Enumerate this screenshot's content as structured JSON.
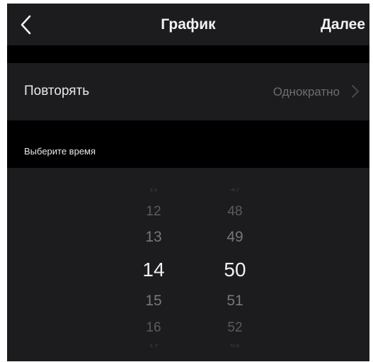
{
  "navbar": {
    "back_icon": "chevron-left-icon",
    "title": "График",
    "next_label": "Далее"
  },
  "repeat_row": {
    "label": "Повторять",
    "value": "Однократно",
    "chevron_icon": "chevron-right-icon"
  },
  "section": {
    "header": "Выберите время"
  },
  "picker": {
    "hours": [
      "11",
      "12",
      "13",
      "14",
      "15",
      "16",
      "17"
    ],
    "minutes": [
      "47",
      "48",
      "49",
      "50",
      "51",
      "52",
      "53"
    ],
    "selected_hour": "14",
    "selected_minute": "50"
  }
}
